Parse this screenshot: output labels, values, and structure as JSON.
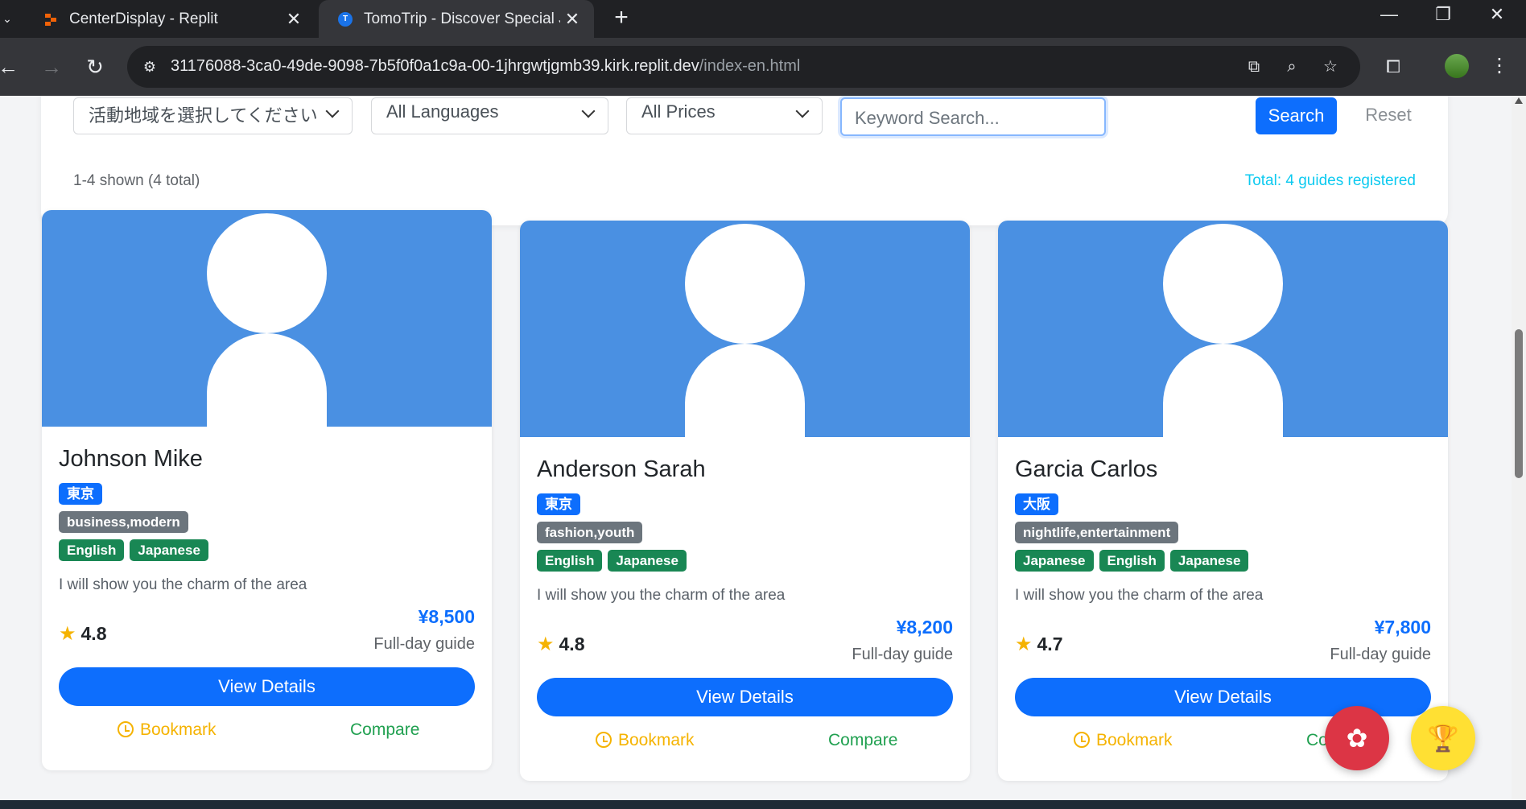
{
  "browser": {
    "tabs": [
      {
        "title": "CenterDisplay - Replit",
        "active": false
      },
      {
        "title": "TomoTrip - Discover Special Jou",
        "active": true
      }
    ],
    "url_host": "31176088-3ca0-49de-9098-7b5f0f0a1c9a-00-1jhrgwtjgmb39.kirk.replit.dev",
    "url_path": "/index-en.html"
  },
  "filters": {
    "region_select": "活動地域を選択してください",
    "language_select": "All Languages",
    "price_select": "All Prices",
    "keyword_placeholder": "Keyword Search...",
    "search_label": "Search",
    "reset_label": "Reset",
    "shown_text": "1-4 shown (4 total)",
    "total_text": "Total: 4 guides registered"
  },
  "guides": [
    {
      "name": "Johnson Mike",
      "location": "東京",
      "tags": "business,modern",
      "languages": [
        "English",
        "Japanese"
      ],
      "description": "I will show you the charm of the area",
      "rating": "4.8",
      "price": "¥8,500",
      "price_type": "Full-day guide",
      "details_label": "View Details",
      "bookmark_label": "Bookmark",
      "compare_label": "Compare"
    },
    {
      "name": "Anderson Sarah",
      "location": "東京",
      "tags": "fashion,youth",
      "languages": [
        "English",
        "Japanese"
      ],
      "description": "I will show you the charm of the area",
      "rating": "4.8",
      "price": "¥8,200",
      "price_type": "Full-day guide",
      "details_label": "View Details",
      "bookmark_label": "Bookmark",
      "compare_label": "Compare"
    },
    {
      "name": "Garcia Carlos",
      "location": "大阪",
      "tags": "nightlife,entertainment",
      "languages": [
        "Japanese",
        "English",
        "Japanese"
      ],
      "description": "I will show you the charm of the area",
      "rating": "4.7",
      "price": "¥7,800",
      "price_type": "Full-day guide",
      "details_label": "View Details",
      "bookmark_label": "Bookmark",
      "compare_label": "Compare"
    }
  ],
  "icons": {
    "star": "star-icon",
    "bookmark": "clock-icon",
    "gear_fab": "gear-icon",
    "trophy_fab": "trophy-icon"
  },
  "colors": {
    "primary": "#0d6efd",
    "photo_bg": "#4a90e2",
    "language_badge": "#198754",
    "tag_badge": "#6c757d",
    "bookmark": "#f5b301",
    "compare": "#20a050",
    "total_text": "#0dcaf0"
  }
}
